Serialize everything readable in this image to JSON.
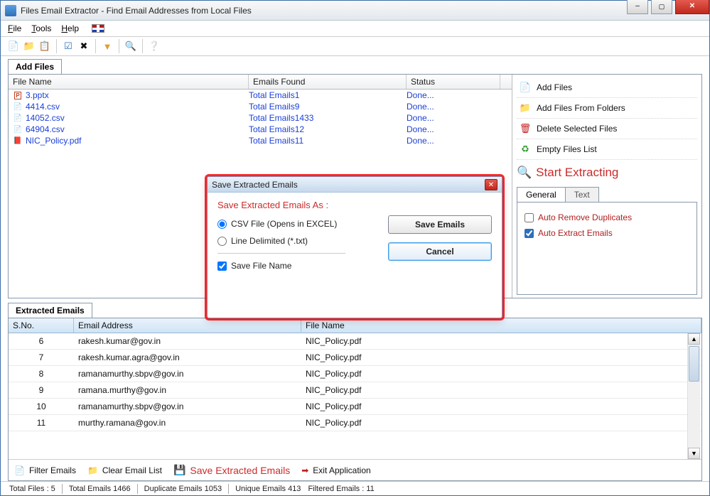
{
  "window": {
    "title": "Files Email Extractor -   Find Email Addresses from Local Files"
  },
  "menu": {
    "file": "File",
    "tools": "Tools",
    "help": "Help"
  },
  "tabs": {
    "add_files": "Add Files",
    "extracted": "Extracted Emails"
  },
  "file_headers": {
    "name": "File Name",
    "emails": "Emails Found",
    "status": "Status"
  },
  "files": [
    {
      "icon": "pptx",
      "name": "3.pptx",
      "emails": "Total Emails1",
      "status": "Done..."
    },
    {
      "icon": "csv",
      "name": "4414.csv",
      "emails": "Total Emails9",
      "status": "Done..."
    },
    {
      "icon": "csv",
      "name": "14052.csv",
      "emails": "Total Emails1433",
      "status": "Done..."
    },
    {
      "icon": "csv",
      "name": "64904.csv",
      "emails": "Total Emails12",
      "status": "Done..."
    },
    {
      "icon": "pdf",
      "name": "NIC_Policy.pdf",
      "emails": "Total Emails11",
      "status": "Done..."
    }
  ],
  "side": {
    "add": "Add Files",
    "folders": "Add Files From Folders",
    "delete": "Delete Selected Files",
    "empty": "Empty Files List",
    "start": "Start Extracting"
  },
  "opts": {
    "tab_general": "General",
    "tab_text": "Text",
    "auto_remove": "Auto Remove Duplicates",
    "auto_extract": "Auto Extract Emails"
  },
  "ext_headers": {
    "sno": "S.No.",
    "email": "Email Address",
    "file": "File Name"
  },
  "extracted": [
    {
      "sno": "6",
      "email": "rakesh.kumar@gov.in",
      "file": "NIC_Policy.pdf"
    },
    {
      "sno": "7",
      "email": "rakesh.kumar.agra@gov.in",
      "file": "NIC_Policy.pdf"
    },
    {
      "sno": "8",
      "email": "ramanamurthy.sbpv@gov.in",
      "file": "NIC_Policy.pdf"
    },
    {
      "sno": "9",
      "email": "ramana.murthy@gov.in",
      "file": "NIC_Policy.pdf"
    },
    {
      "sno": "10",
      "email": "ramanamurthy.sbpv@gov.in",
      "file": "NIC_Policy.pdf"
    },
    {
      "sno": "11",
      "email": "murthy.ramana@gov.in",
      "file": "NIC_Policy.pdf"
    }
  ],
  "bottom": {
    "filter": "Filter Emails",
    "clear": "Clear Email List",
    "save": "Save Extracted Emails",
    "exit": "Exit Application"
  },
  "status": {
    "total_files": "Total Files :  5",
    "total_emails": "Total Emails  1466",
    "dup": "Duplicate Emails  1053",
    "unique": "Unique Emails  413",
    "filtered": "Filtered Emails :  11"
  },
  "dialog": {
    "title": "Save Extracted Emails",
    "heading": "Save Extracted Emails As :",
    "opt_csv": "CSV File (Opens in EXCEL)",
    "opt_txt": "Line Delimited (*.txt)",
    "save_name": "Save File Name",
    "btn_save": "Save Emails",
    "btn_cancel": "Cancel"
  }
}
